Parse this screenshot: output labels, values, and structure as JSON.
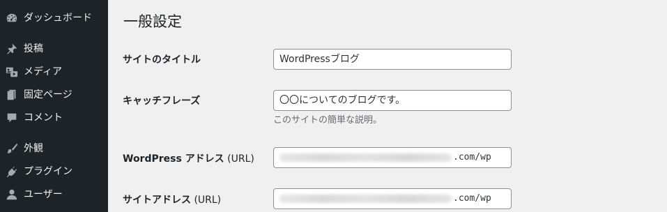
{
  "sidebar": {
    "items": [
      {
        "label": "ダッシュボード",
        "icon": "dashboard-icon"
      },
      {
        "label": "投稿",
        "icon": "pin-icon"
      },
      {
        "label": "メディア",
        "icon": "media-icon"
      },
      {
        "label": "固定ページ",
        "icon": "page-icon"
      },
      {
        "label": "コメント",
        "icon": "comment-icon"
      },
      {
        "label": "外観",
        "icon": "brush-icon"
      },
      {
        "label": "プラグイン",
        "icon": "plugin-icon"
      },
      {
        "label": "ユーザー",
        "icon": "user-icon"
      }
    ]
  },
  "page": {
    "title": "一般設定"
  },
  "settings": {
    "site_title": {
      "label": "サイトのタイトル",
      "value": "WordPressブログ"
    },
    "tagline": {
      "label": "キャッチフレーズ",
      "value": "〇〇についてのブログです。",
      "description": "このサイトの簡単な説明。"
    },
    "wp_address": {
      "label_main": "WordPress アドレス",
      "label_suffix": " (URL)",
      "value_suffix": ".com/wp"
    },
    "site_address": {
      "label_main": "サイトアドレス",
      "label_suffix": " (URL)",
      "value_suffix": ".com/wp"
    }
  },
  "colors": {
    "sidebar_bg": "#1d2327",
    "sidebar_text": "#f0f0f1",
    "sidebar_icon": "#a7aaad",
    "content_bg": "#f0f0f1",
    "description_text": "#646970"
  }
}
